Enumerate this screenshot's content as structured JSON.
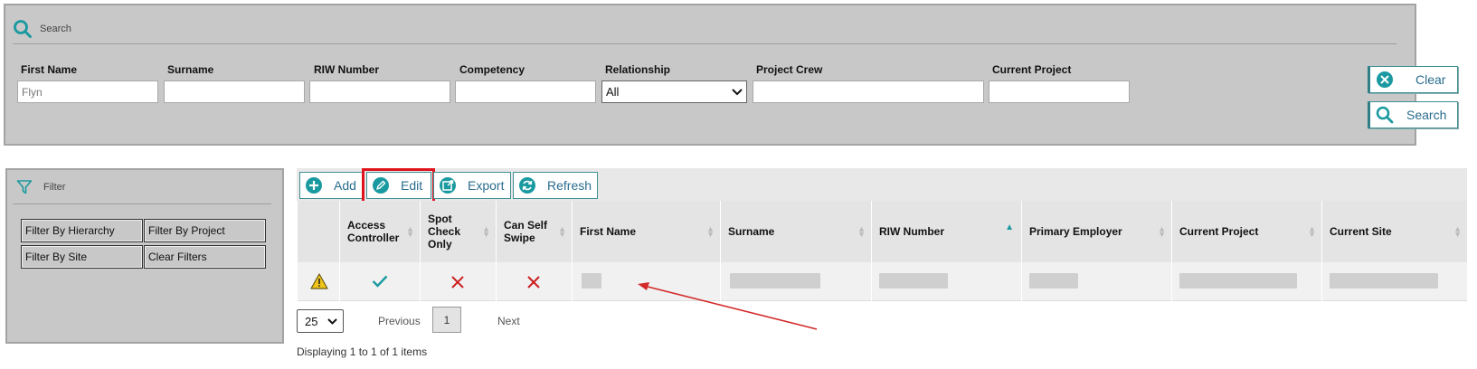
{
  "search": {
    "header_label": "Search",
    "fields": [
      {
        "label": "First Name",
        "value": "Flyn"
      },
      {
        "label": "Surname",
        "value": ""
      },
      {
        "label": "RIW Number",
        "value": ""
      },
      {
        "label": "Competency",
        "value": ""
      },
      {
        "label": "Relationship",
        "value": "All"
      },
      {
        "label": "Project Crew",
        "value": ""
      },
      {
        "label": "Current Project",
        "value": ""
      }
    ],
    "clear_label": "Clear",
    "search_label": "Search"
  },
  "filter": {
    "header_label": "Filter",
    "buttons": [
      "Filter By Hierarchy",
      "Filter By Project",
      "Filter By Site",
      "Clear Filters"
    ]
  },
  "toolbar": {
    "add_label": "Add",
    "edit_label": "Edit",
    "export_label": "Export",
    "refresh_label": "Refresh"
  },
  "grid": {
    "columns": [
      "",
      "Access Controller",
      "Spot Check Only",
      "Can Self Swipe",
      "First Name",
      "Surname",
      "RIW Number",
      "Primary Employer",
      "Current Project",
      "Current Site"
    ],
    "sorted_column": "RIW Number",
    "rows": [
      {
        "warning": true,
        "access_controller": true,
        "spot_check_only": false,
        "can_self_swipe": false
      }
    ]
  },
  "pager": {
    "page_size": "25",
    "previous_label": "Previous",
    "current_page": "1",
    "next_label": "Next",
    "info": "Displaying 1 to 1 of 1 items"
  },
  "colors": {
    "accent": "#1a9aa0",
    "highlight": "#e0141e",
    "arrow": "#d42a2a",
    "cross": "#cc1f1f",
    "warning": "#f0c419"
  }
}
